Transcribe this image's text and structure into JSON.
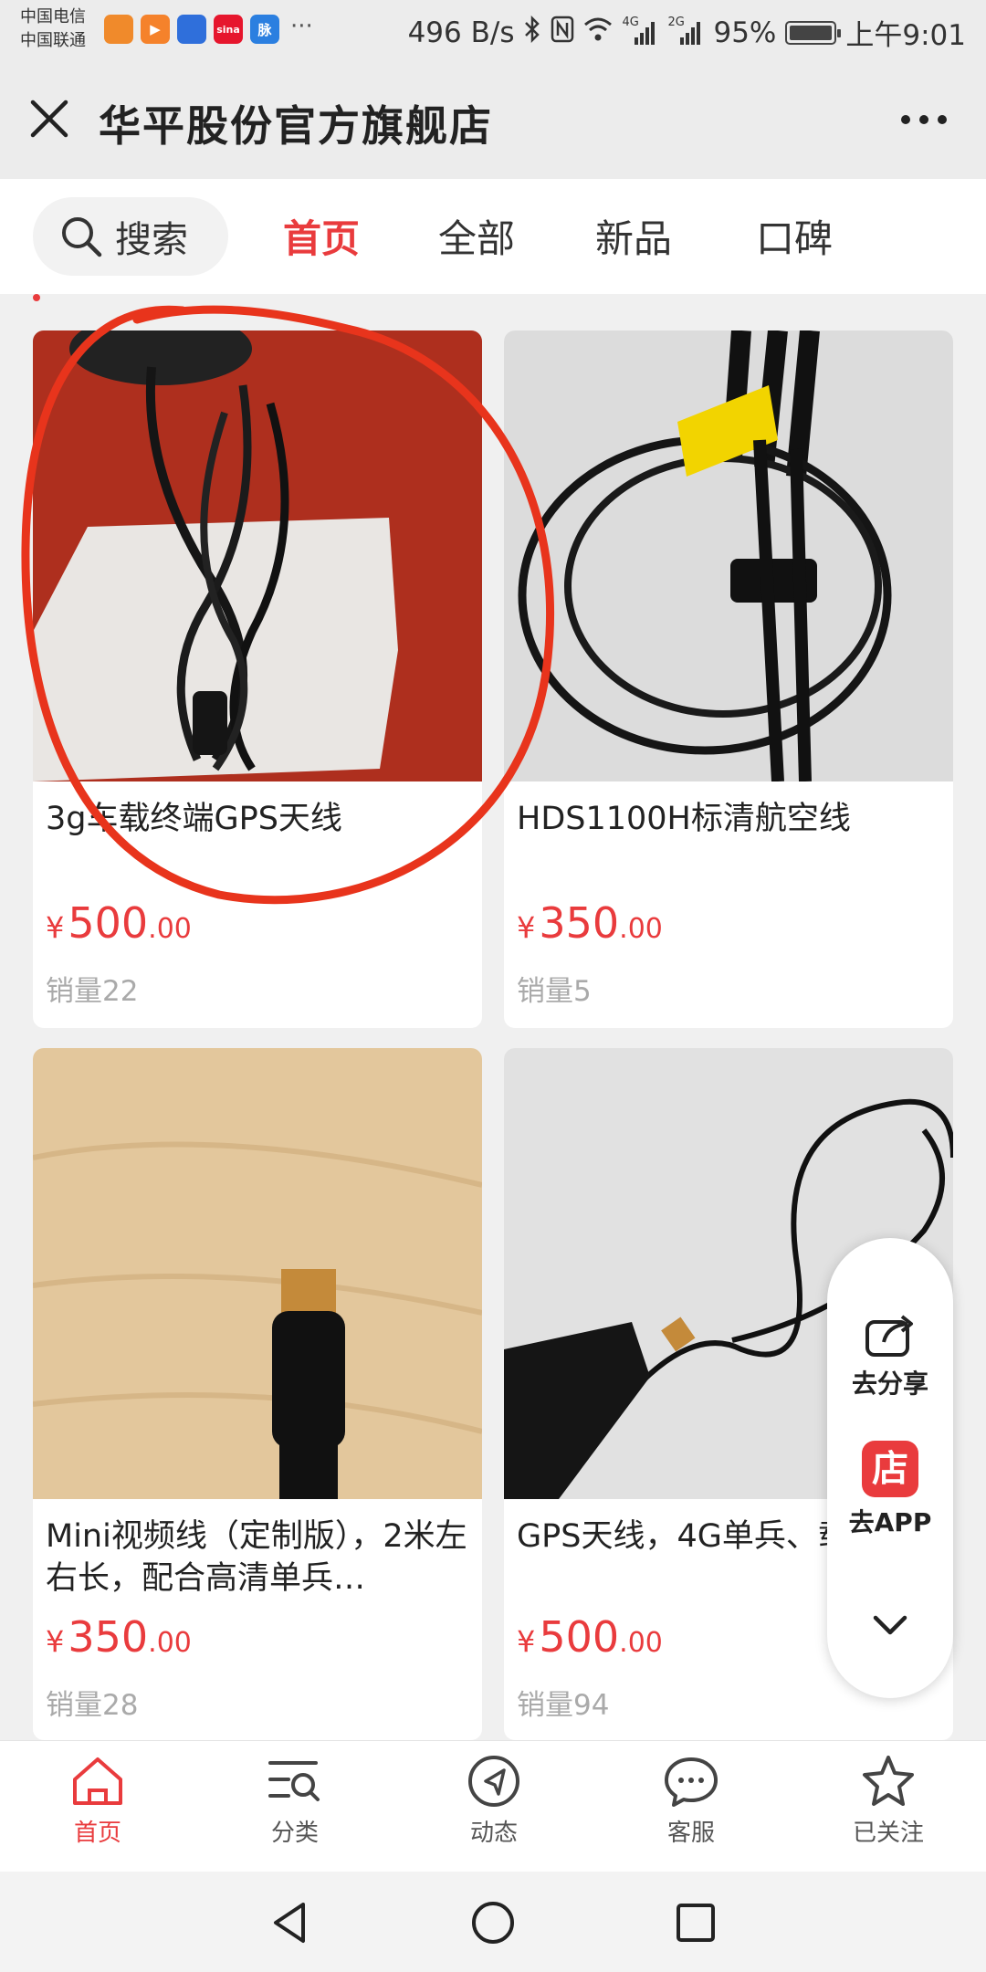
{
  "status_bar": {
    "carrier_1": "中国电信",
    "carrier_2": "中国联通",
    "more": "···",
    "speed": "496 B/s",
    "network_1": "4G",
    "network_2": "2G",
    "battery_level": 0.95,
    "battery": "95%",
    "time": "上午9:01",
    "app_icons": [
      {
        "name": "uc-browser",
        "glyph": "",
        "color": "#f08a2b"
      },
      {
        "name": "video-app",
        "glyph": "▶",
        "color": "#f5822b"
      },
      {
        "name": "baidu",
        "glyph": "",
        "color": "#2f6fdb"
      },
      {
        "name": "sina",
        "glyph": "sina",
        "color": "#e6162d"
      },
      {
        "name": "maimai",
        "glyph": "脉",
        "color": "#2b7fe0"
      }
    ]
  },
  "nav": {
    "title": "华平股份官方旗舰店"
  },
  "store_tabs": {
    "search_label": "搜索",
    "tabs": [
      "首页",
      "全部",
      "新品",
      "口碑"
    ],
    "active_index": 0
  },
  "products": [
    {
      "name": "3g车载终端GPS天线",
      "currency": "¥",
      "price_int": "500",
      "price_dec": ".00",
      "sales": "销量22"
    },
    {
      "name": "HDS1100H标清航空线",
      "currency": "¥",
      "price_int": "350",
      "price_dec": ".00",
      "sales": "销量5"
    },
    {
      "name": "Mini视频线（定制版），2米左右长，配合高清单兵…",
      "currency": "¥",
      "price_int": "350",
      "price_dec": ".00",
      "sales": "销量28"
    },
    {
      "name": "GPS天线，4G单兵、载标配",
      "currency": "¥",
      "price_int": "500",
      "price_dec": ".00",
      "sales": "销量94"
    }
  ],
  "floating": {
    "share_label": "去分享",
    "app_icon_text": "店",
    "app_label": "去APP"
  },
  "bottom_tabs": [
    {
      "label": "首页",
      "icon": "home-icon"
    },
    {
      "label": "分类",
      "icon": "category-search-icon"
    },
    {
      "label": "动态",
      "icon": "compass-icon"
    },
    {
      "label": "客服",
      "icon": "chat-icon"
    },
    {
      "label": "已关注",
      "icon": "star-icon"
    }
  ],
  "colors": {
    "accent": "#e93b3d",
    "annotation": "#e8341c"
  }
}
